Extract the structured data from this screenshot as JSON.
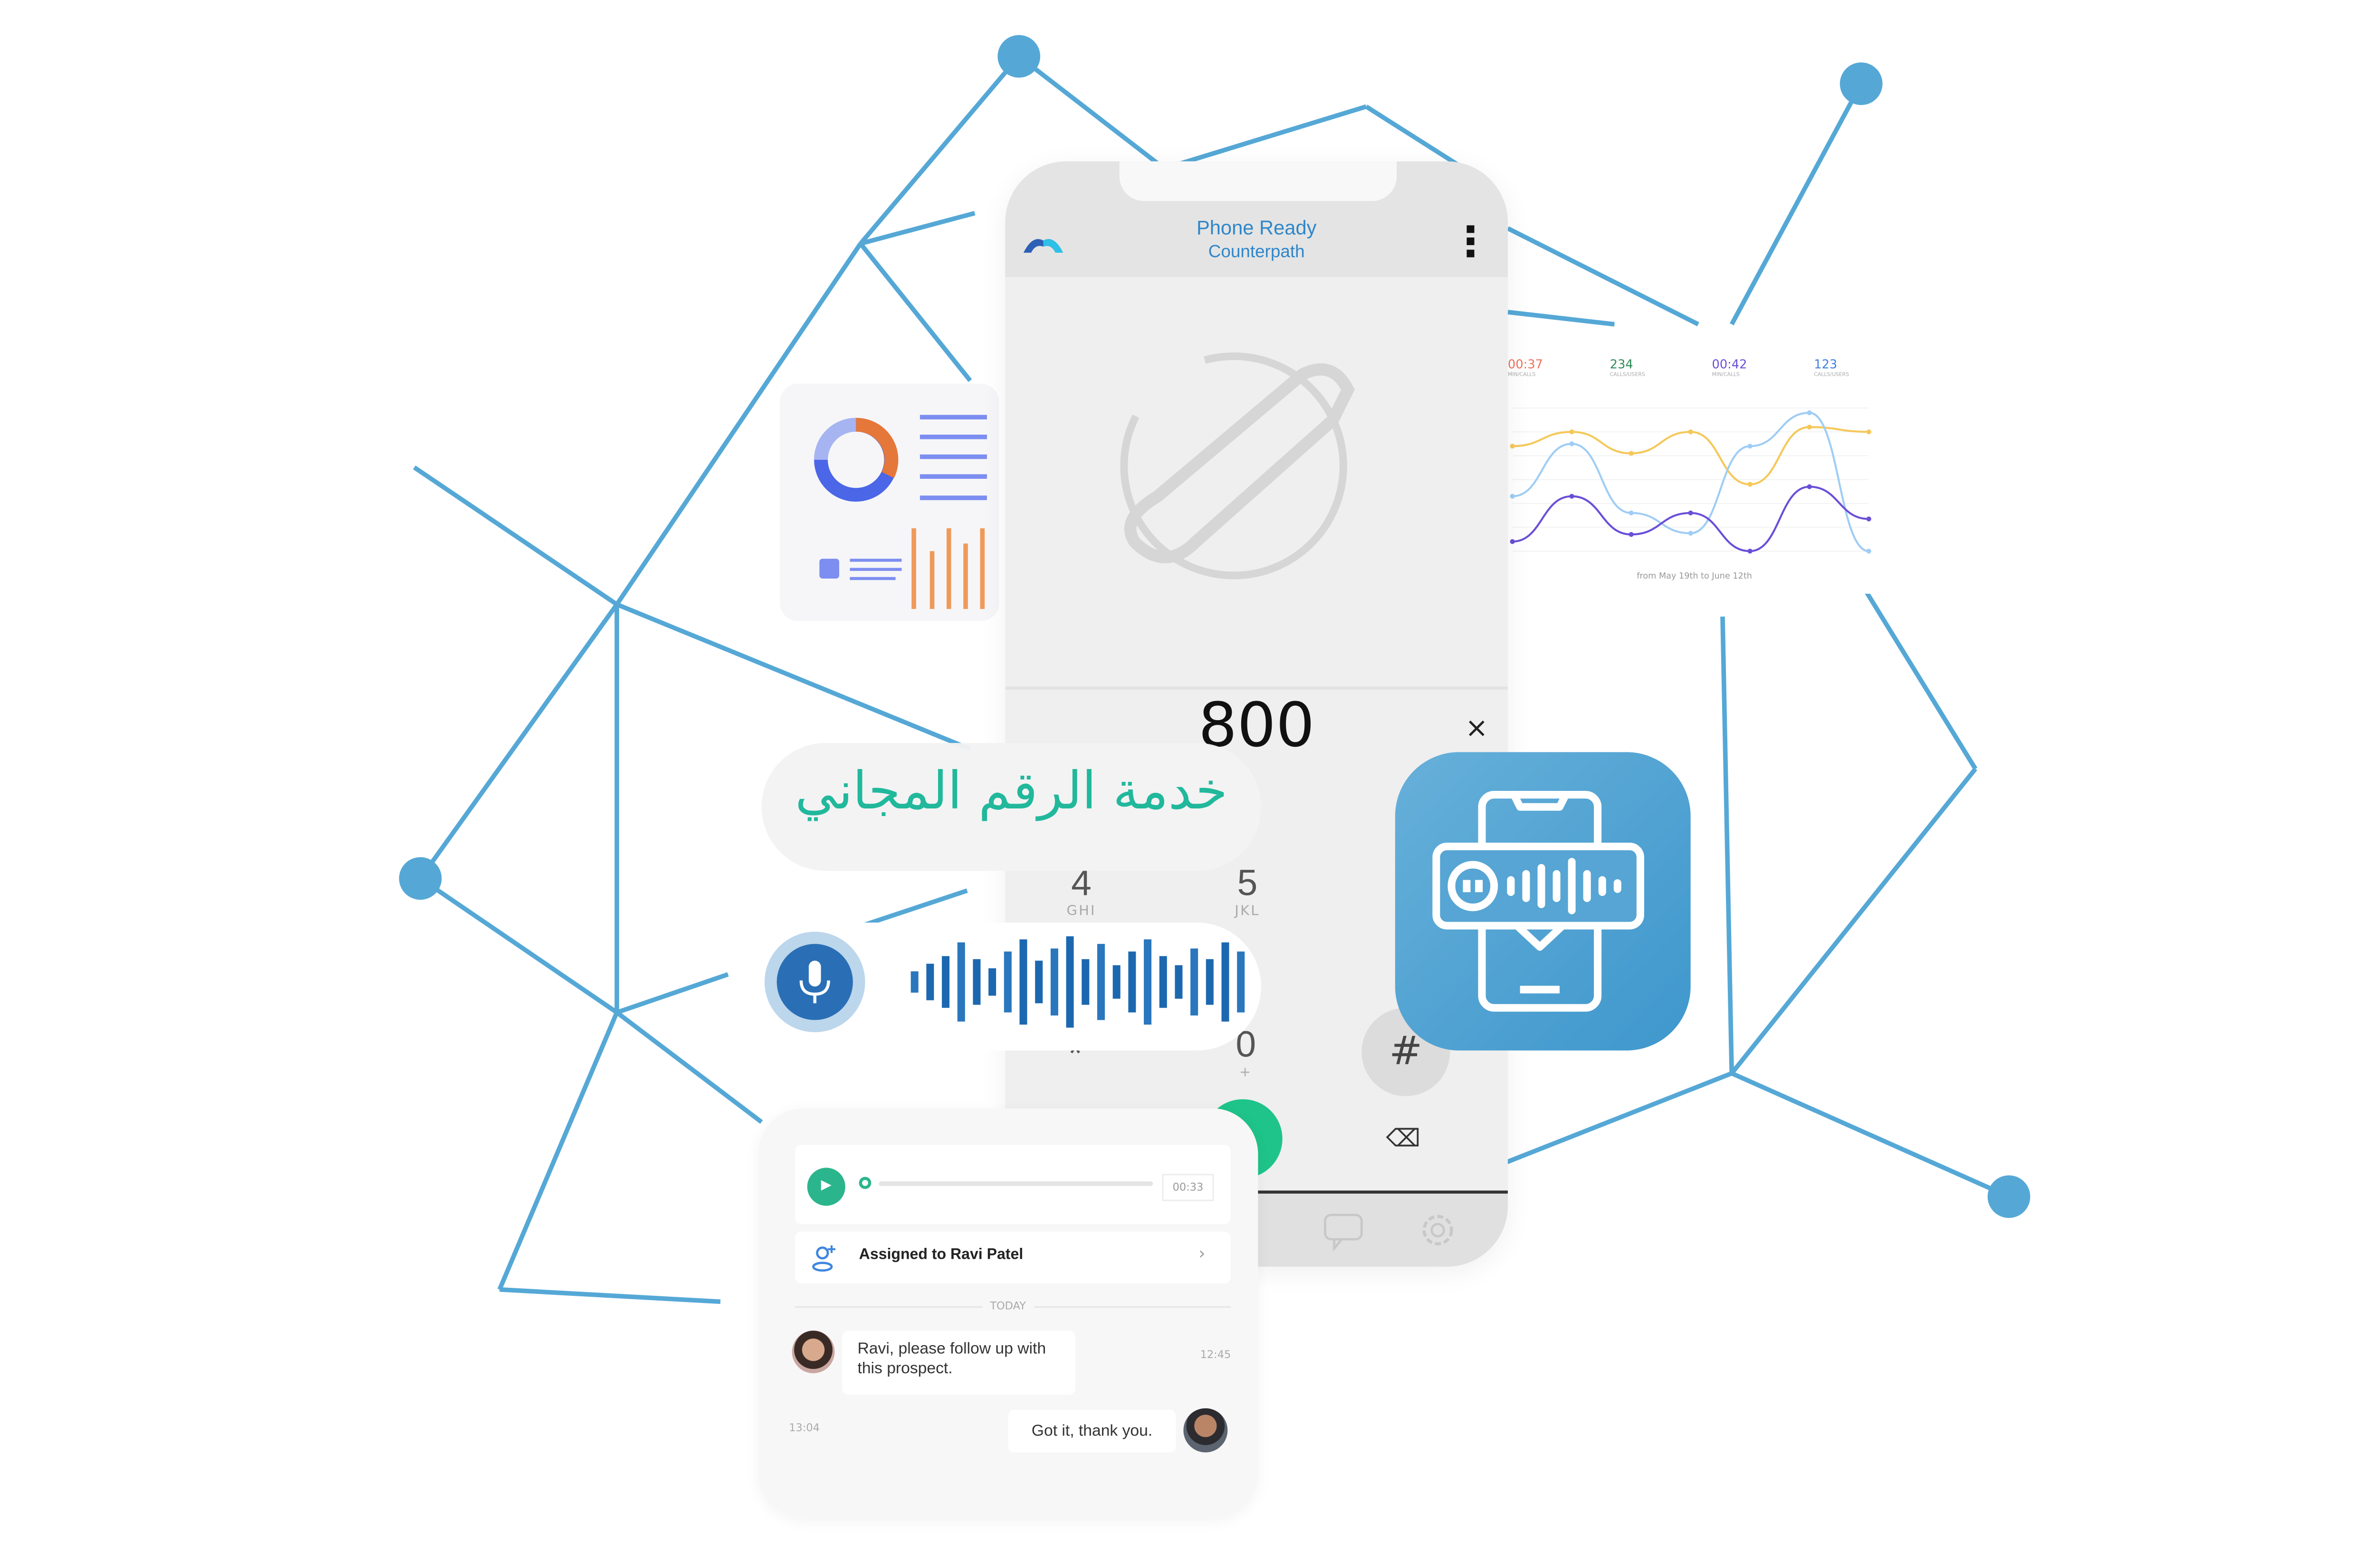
{
  "phone": {
    "title": "Phone Ready",
    "subtitle": "Counterpath",
    "number": "800",
    "clear_icon": "×",
    "keys": [
      {
        "digit": "4",
        "letters": "GHI"
      },
      {
        "digit": "5",
        "letters": "JKL"
      },
      {
        "digit": "*",
        "letters": ""
      },
      {
        "digit": "0",
        "letters": "+"
      }
    ],
    "hash": "#",
    "backspace_icon": "⌫",
    "nav_icons": [
      "chat-icon",
      "gear-icon"
    ]
  },
  "banner": {
    "text": "خدمة الرقم المجاني",
    "color": "#21b89c"
  },
  "colors": {
    "network": "#55a8d6",
    "accent": "#2f86c9",
    "call": "#1fc48a",
    "app_icon": "#4aa2d2"
  },
  "chart_data": {
    "type": "line",
    "stats": [
      {
        "value": "00:37",
        "label": "MIN/CALLS",
        "color": "#f0715a"
      },
      {
        "value": "234",
        "label": "CALLS/USERS",
        "color": "#2e8b57"
      },
      {
        "value": "00:42",
        "label": "MIN/CALLS",
        "color": "#6a4fd8"
      },
      {
        "value": "123",
        "label": "CALLS/USERS",
        "color": "#3f7fe0"
      }
    ],
    "x": [
      1,
      2,
      3,
      4,
      5,
      6,
      7
    ],
    "ylim": [
      0,
      6
    ],
    "grid": true,
    "series": [
      {
        "color": "#f5c85a",
        "values": [
          4.4,
          5.0,
          4.1,
          5.0,
          2.8,
          5.2,
          5.0
        ]
      },
      {
        "color": "#9fcdf5",
        "values": [
          2.3,
          4.5,
          1.6,
          0.75,
          4.4,
          5.8,
          0
        ]
      },
      {
        "color": "#6a4fd8",
        "values": [
          0.4,
          2.3,
          0.7,
          1.6,
          0,
          2.7,
          1.35
        ]
      }
    ],
    "footnote": "from May 19th to June 12th"
  },
  "chat": {
    "duration": "00:33",
    "assigned": "Assigned to Ravi Patel",
    "divider": "TODAY",
    "messages": [
      {
        "text": "Ravi, please follow up with this prospect.",
        "time": "12:45"
      },
      {
        "text": "Got it, thank you.",
        "time": "13:04"
      }
    ]
  }
}
